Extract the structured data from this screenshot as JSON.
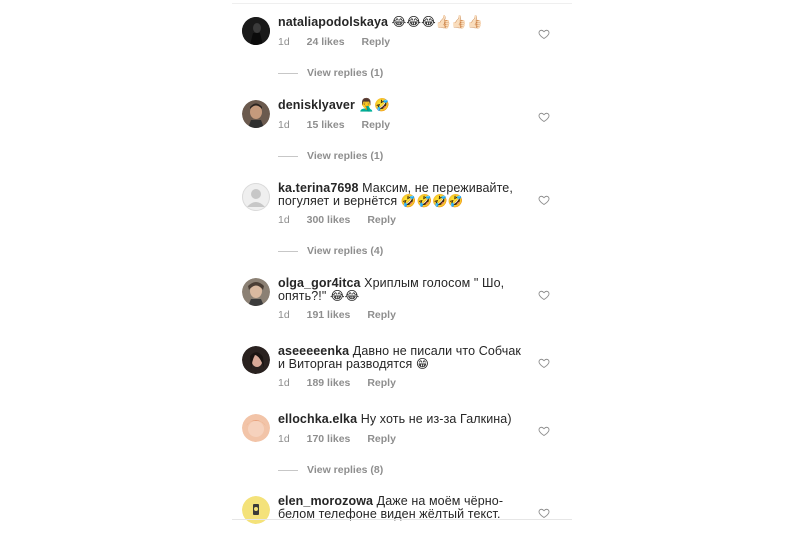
{
  "comments": [
    {
      "username": "nataliapodolskaya",
      "text": "😂😂😂👍🏻👍🏻👍🏻",
      "age": "1d",
      "likes": "24 likes",
      "reply": "Reply",
      "view_replies": "View replies (1)"
    },
    {
      "username": "denisklyaver",
      "text": "🤦‍♂️🤣",
      "age": "1d",
      "likes": "15 likes",
      "reply": "Reply",
      "view_replies": "View replies (1)"
    },
    {
      "username": "ka.terina7698",
      "text": "Максим, не переживайте, погуляет и вернётся 🤣🤣🤣🤣",
      "age": "1d",
      "likes": "300 likes",
      "reply": "Reply",
      "view_replies": "View replies (4)"
    },
    {
      "username": "olga_gor4itca",
      "text": "Хриплым голосом \" Шо, опять?!\" 😂😂",
      "age": "1d",
      "likes": "191 likes",
      "reply": "Reply"
    },
    {
      "username": "aseeeeenka",
      "text": "Давно не писали что Собчак и Виторган разводятся 😁",
      "age": "1d",
      "likes": "189 likes",
      "reply": "Reply"
    },
    {
      "username": "ellochka.elka",
      "text": "Ну хоть не из-за Галкина)",
      "age": "1d",
      "likes": "170 likes",
      "reply": "Reply",
      "view_replies": "View replies (8)"
    },
    {
      "username": "elen_morozowa",
      "text": "Даже на моём чёрно-белом телефоне виден жёлтый текст."
    }
  ],
  "icons": {
    "heart": "heart-outline-icon",
    "avatar": "user-avatar"
  },
  "colors": {
    "text": "#262626",
    "secondary": "#8e8e8e",
    "divider": "#c7c7c7"
  }
}
